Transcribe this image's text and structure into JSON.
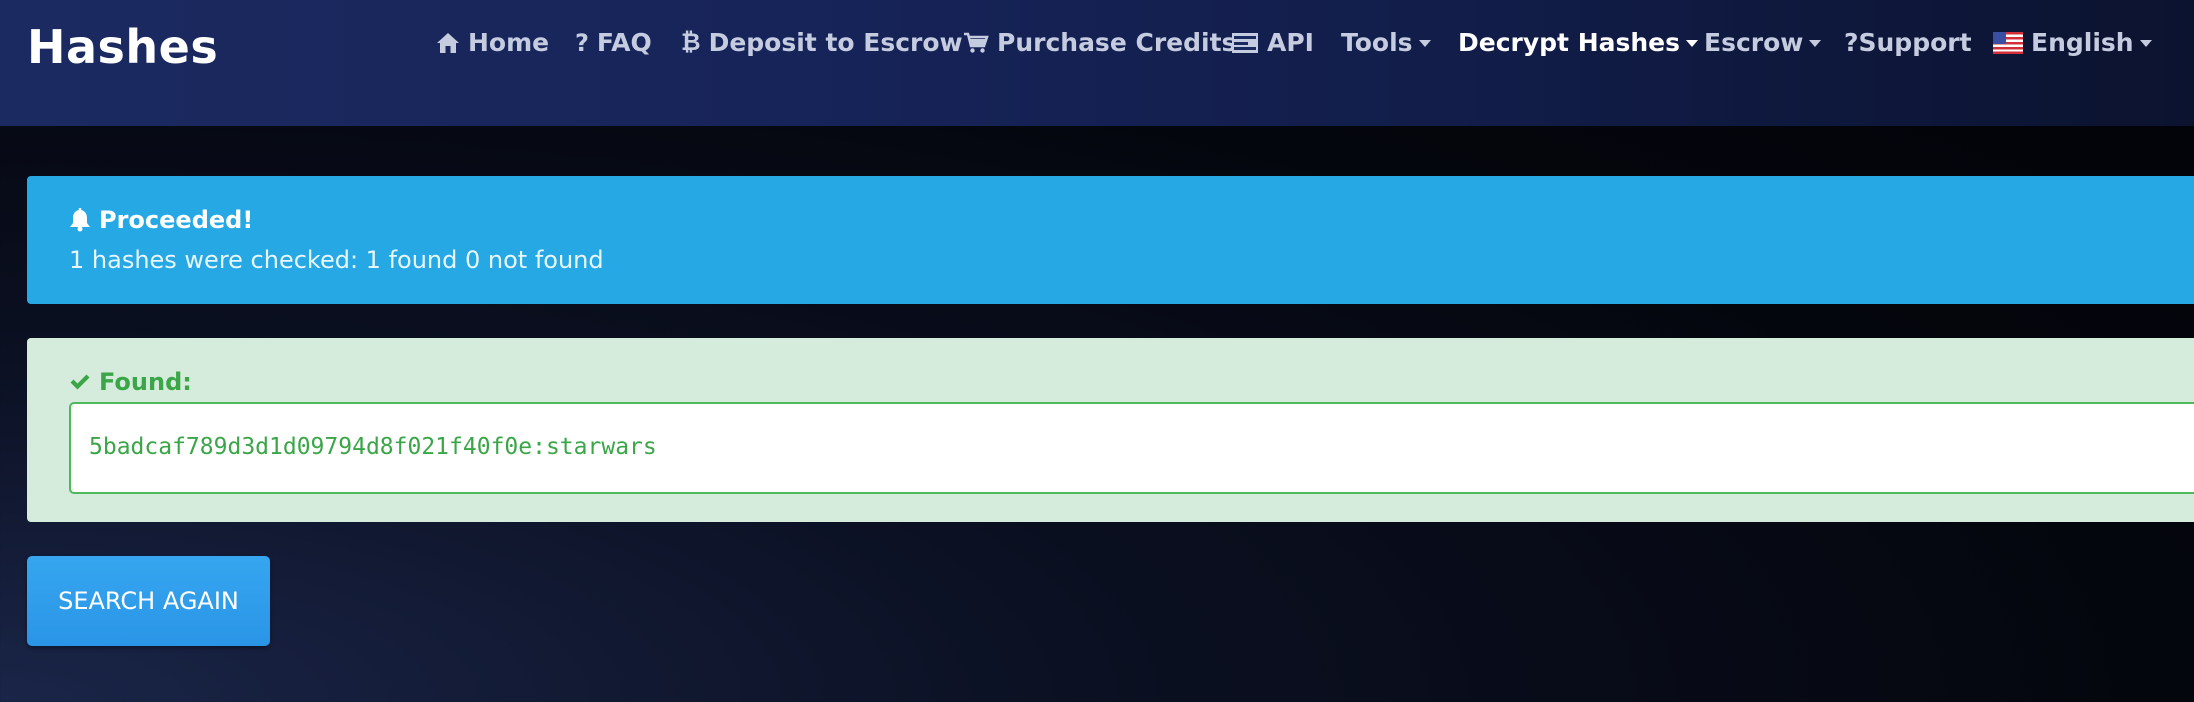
{
  "brand": "Hashes",
  "nav": [
    {
      "label": "Home",
      "icon": "home-icon",
      "dropdown": false
    },
    {
      "label": "FAQ",
      "icon": "question-icon",
      "dropdown": false
    },
    {
      "label": "Deposit to Escrow",
      "icon": "bitcoin-icon",
      "dropdown": false
    },
    {
      "label": "Purchase Credits",
      "icon": "cart-icon",
      "dropdown": false
    },
    {
      "label": "API",
      "icon": "api-icon",
      "dropdown": false
    },
    {
      "label": "Tools",
      "icon": null,
      "dropdown": true
    },
    {
      "label": "Decrypt Hashes",
      "icon": null,
      "dropdown": true,
      "active": true
    },
    {
      "label": "Escrow",
      "icon": null,
      "dropdown": true
    },
    {
      "label": "?Support",
      "icon": null,
      "dropdown": false
    },
    {
      "label": "English",
      "icon": "us-flag-icon",
      "dropdown": true
    }
  ],
  "alert": {
    "title": "Proceeded!",
    "message": "1 hashes were checked: 1 found 0 not found",
    "icon": "bell-icon"
  },
  "found": {
    "title": "Found:",
    "icon": "check-icon",
    "result": "5badcaf789d3d1d09794d8f021f40f0e:starwars"
  },
  "button": {
    "search_again": "SEARCH AGAIN"
  },
  "colors": {
    "navbar": "#17245a",
    "info": "#25a8e4",
    "success_bg": "#d5ecdc",
    "success_text": "#3aa648",
    "button": "#2f9cea"
  }
}
